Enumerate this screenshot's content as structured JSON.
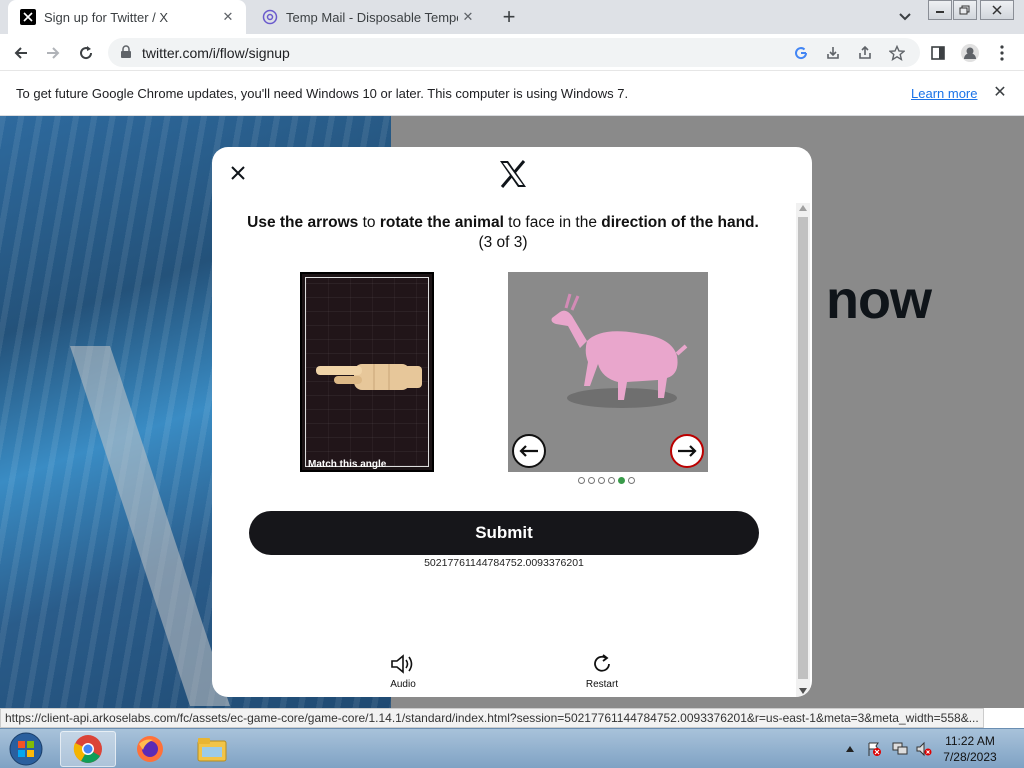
{
  "browser": {
    "tabs": [
      {
        "title": "Sign up for Twitter / X",
        "active": true
      },
      {
        "title": "Temp Mail - Disposable Temporary",
        "active": false
      }
    ],
    "url": "twitter.com/i/flow/signup",
    "infobar": {
      "message": "To get future Google Chrome updates, you'll need Windows 10 or later. This computer is using Windows 7.",
      "link": "Learn more"
    },
    "status_url": "https://client-api.arkoselabs.com/fc/assets/ec-game-core/game-core/1.14.1/standard/index.html?session=50217761144784752.0093376201&r=us-east-1&meta=3&meta_width=558&..."
  },
  "page": {
    "background_word": "now"
  },
  "modal": {
    "instruction_parts": {
      "p1": "Use the arrows",
      "p2": " to ",
      "p3": "rotate the animal",
      "p4": " to face in the ",
      "p5": "direction of the hand."
    },
    "step": "(3 of 3)",
    "reference_caption": "Match this angle",
    "dots": {
      "total": 6,
      "active": 5
    },
    "submit_label": "Submit",
    "session_id": "50217761144784752.0093376201",
    "audio_label": "Audio",
    "restart_label": "Restart"
  },
  "taskbar": {
    "time": "11:22 AM",
    "date": "7/28/2023"
  }
}
